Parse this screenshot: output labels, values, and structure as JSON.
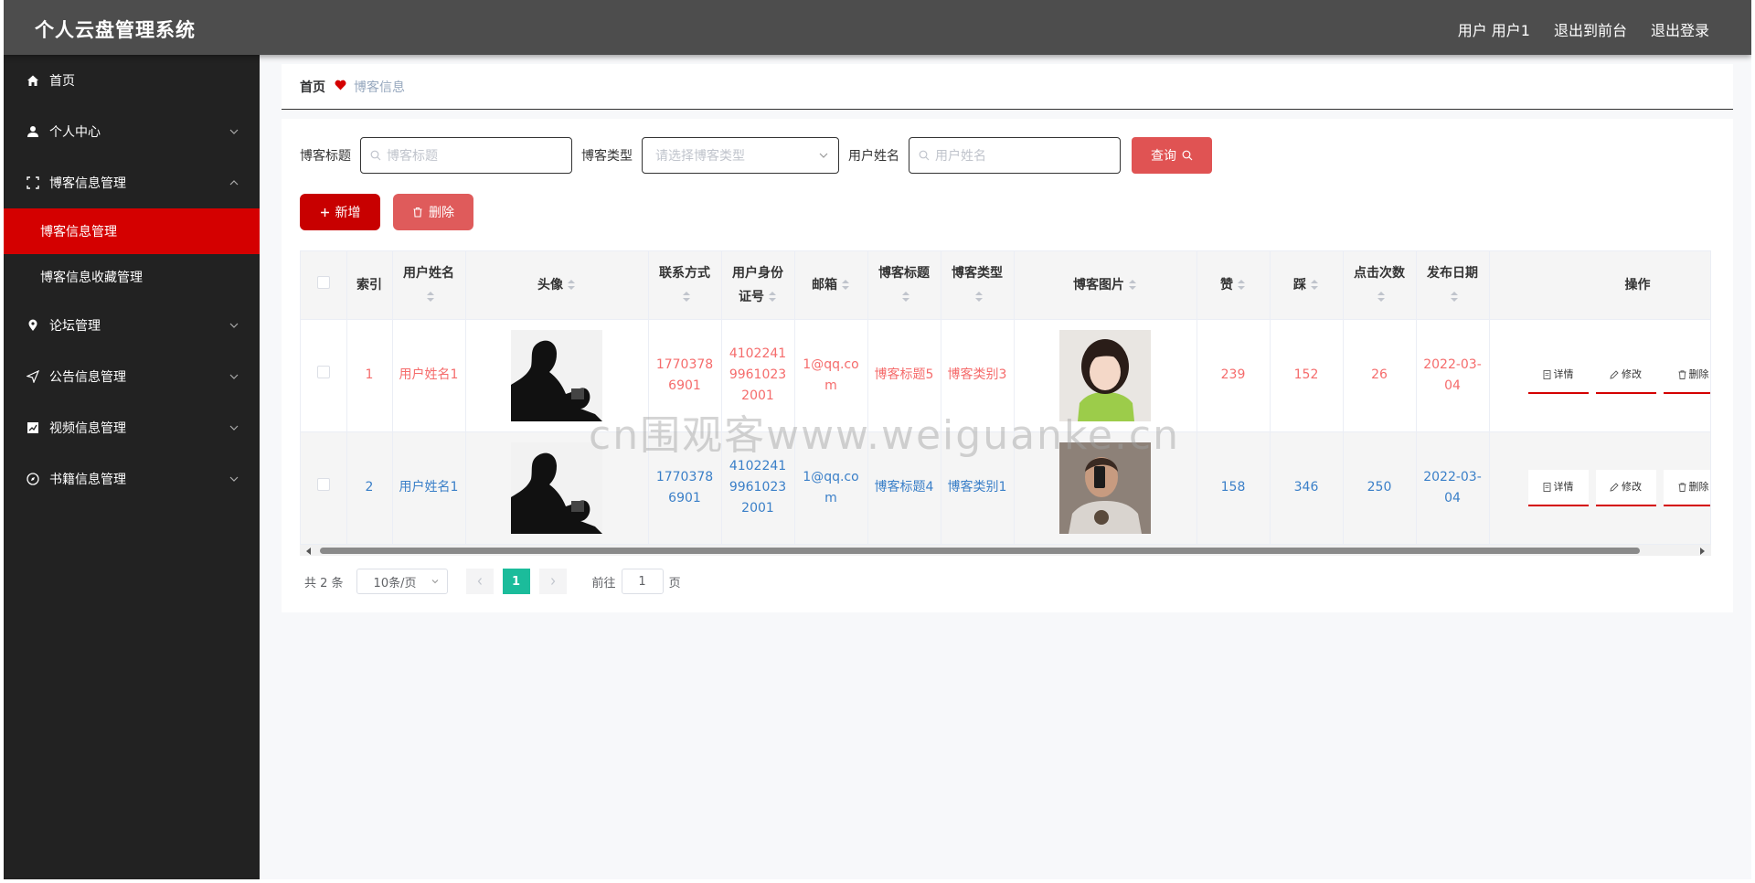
{
  "header": {
    "title": "个人云盘管理系统",
    "user_label": "用户 用户1",
    "to_front": "退出到前台",
    "logout": "退出登录"
  },
  "sidebar": {
    "items": [
      {
        "label": "首页",
        "icon": "home-icon"
      },
      {
        "label": "个人中心",
        "icon": "user-icon"
      },
      {
        "label": "博客信息管理",
        "icon": "fullscreen-icon"
      },
      {
        "label": "博客信息管理",
        "sub": true,
        "active": true
      },
      {
        "label": "博客信息收藏管理",
        "sub": true
      },
      {
        "label": "论坛管理",
        "icon": "location-icon"
      },
      {
        "label": "公告信息管理",
        "icon": "send-icon"
      },
      {
        "label": "视频信息管理",
        "icon": "chart-icon"
      },
      {
        "label": "书籍信息管理",
        "icon": "compass-icon"
      }
    ],
    "active_color": "#d40000"
  },
  "breadcrumb": {
    "home": "首页",
    "current": "博客信息"
  },
  "search": {
    "title_label": "博客标题",
    "title_placeholder": "博客标题",
    "type_label": "博客类型",
    "type_placeholder": "请选择博客类型",
    "name_label": "用户姓名",
    "name_placeholder": "用户姓名",
    "query_label": "查询"
  },
  "actions": {
    "add_label": "新增",
    "delete_label": "删除"
  },
  "table": {
    "columns": [
      "索引",
      "用户姓名",
      "头像",
      "联系方式",
      "用户身份证号",
      "邮箱",
      "博客标题",
      "博客类型",
      "博客图片",
      "赞",
      "踩",
      "点击次数",
      "发布日期",
      "操作"
    ],
    "rows": [
      {
        "index": "1",
        "name": "用户姓名1",
        "phone": "17703786901",
        "idcard": "410224199610232001",
        "email": "1@qq.com",
        "title": "博客标题5",
        "type": "博客类别3",
        "like": "239",
        "dislike": "152",
        "clicks": "26",
        "date": "2022-03-04"
      },
      {
        "index": "2",
        "name": "用户姓名1",
        "phone": "17703786901",
        "idcard": "410224199610232001",
        "email": "1@qq.com",
        "title": "博客标题4",
        "type": "博客类别1",
        "like": "158",
        "dislike": "346",
        "clicks": "250",
        "date": "2022-03-04"
      }
    ],
    "ops": {
      "detail": "详情",
      "edit": "修改",
      "delete": "删除"
    }
  },
  "pager": {
    "total": "共 2 条",
    "page_size": "10条/页",
    "current": "1",
    "goto_prefix": "前往",
    "goto_value": "1",
    "goto_suffix": "页"
  },
  "watermark": "cn围观客www.weiguanke.cn"
}
